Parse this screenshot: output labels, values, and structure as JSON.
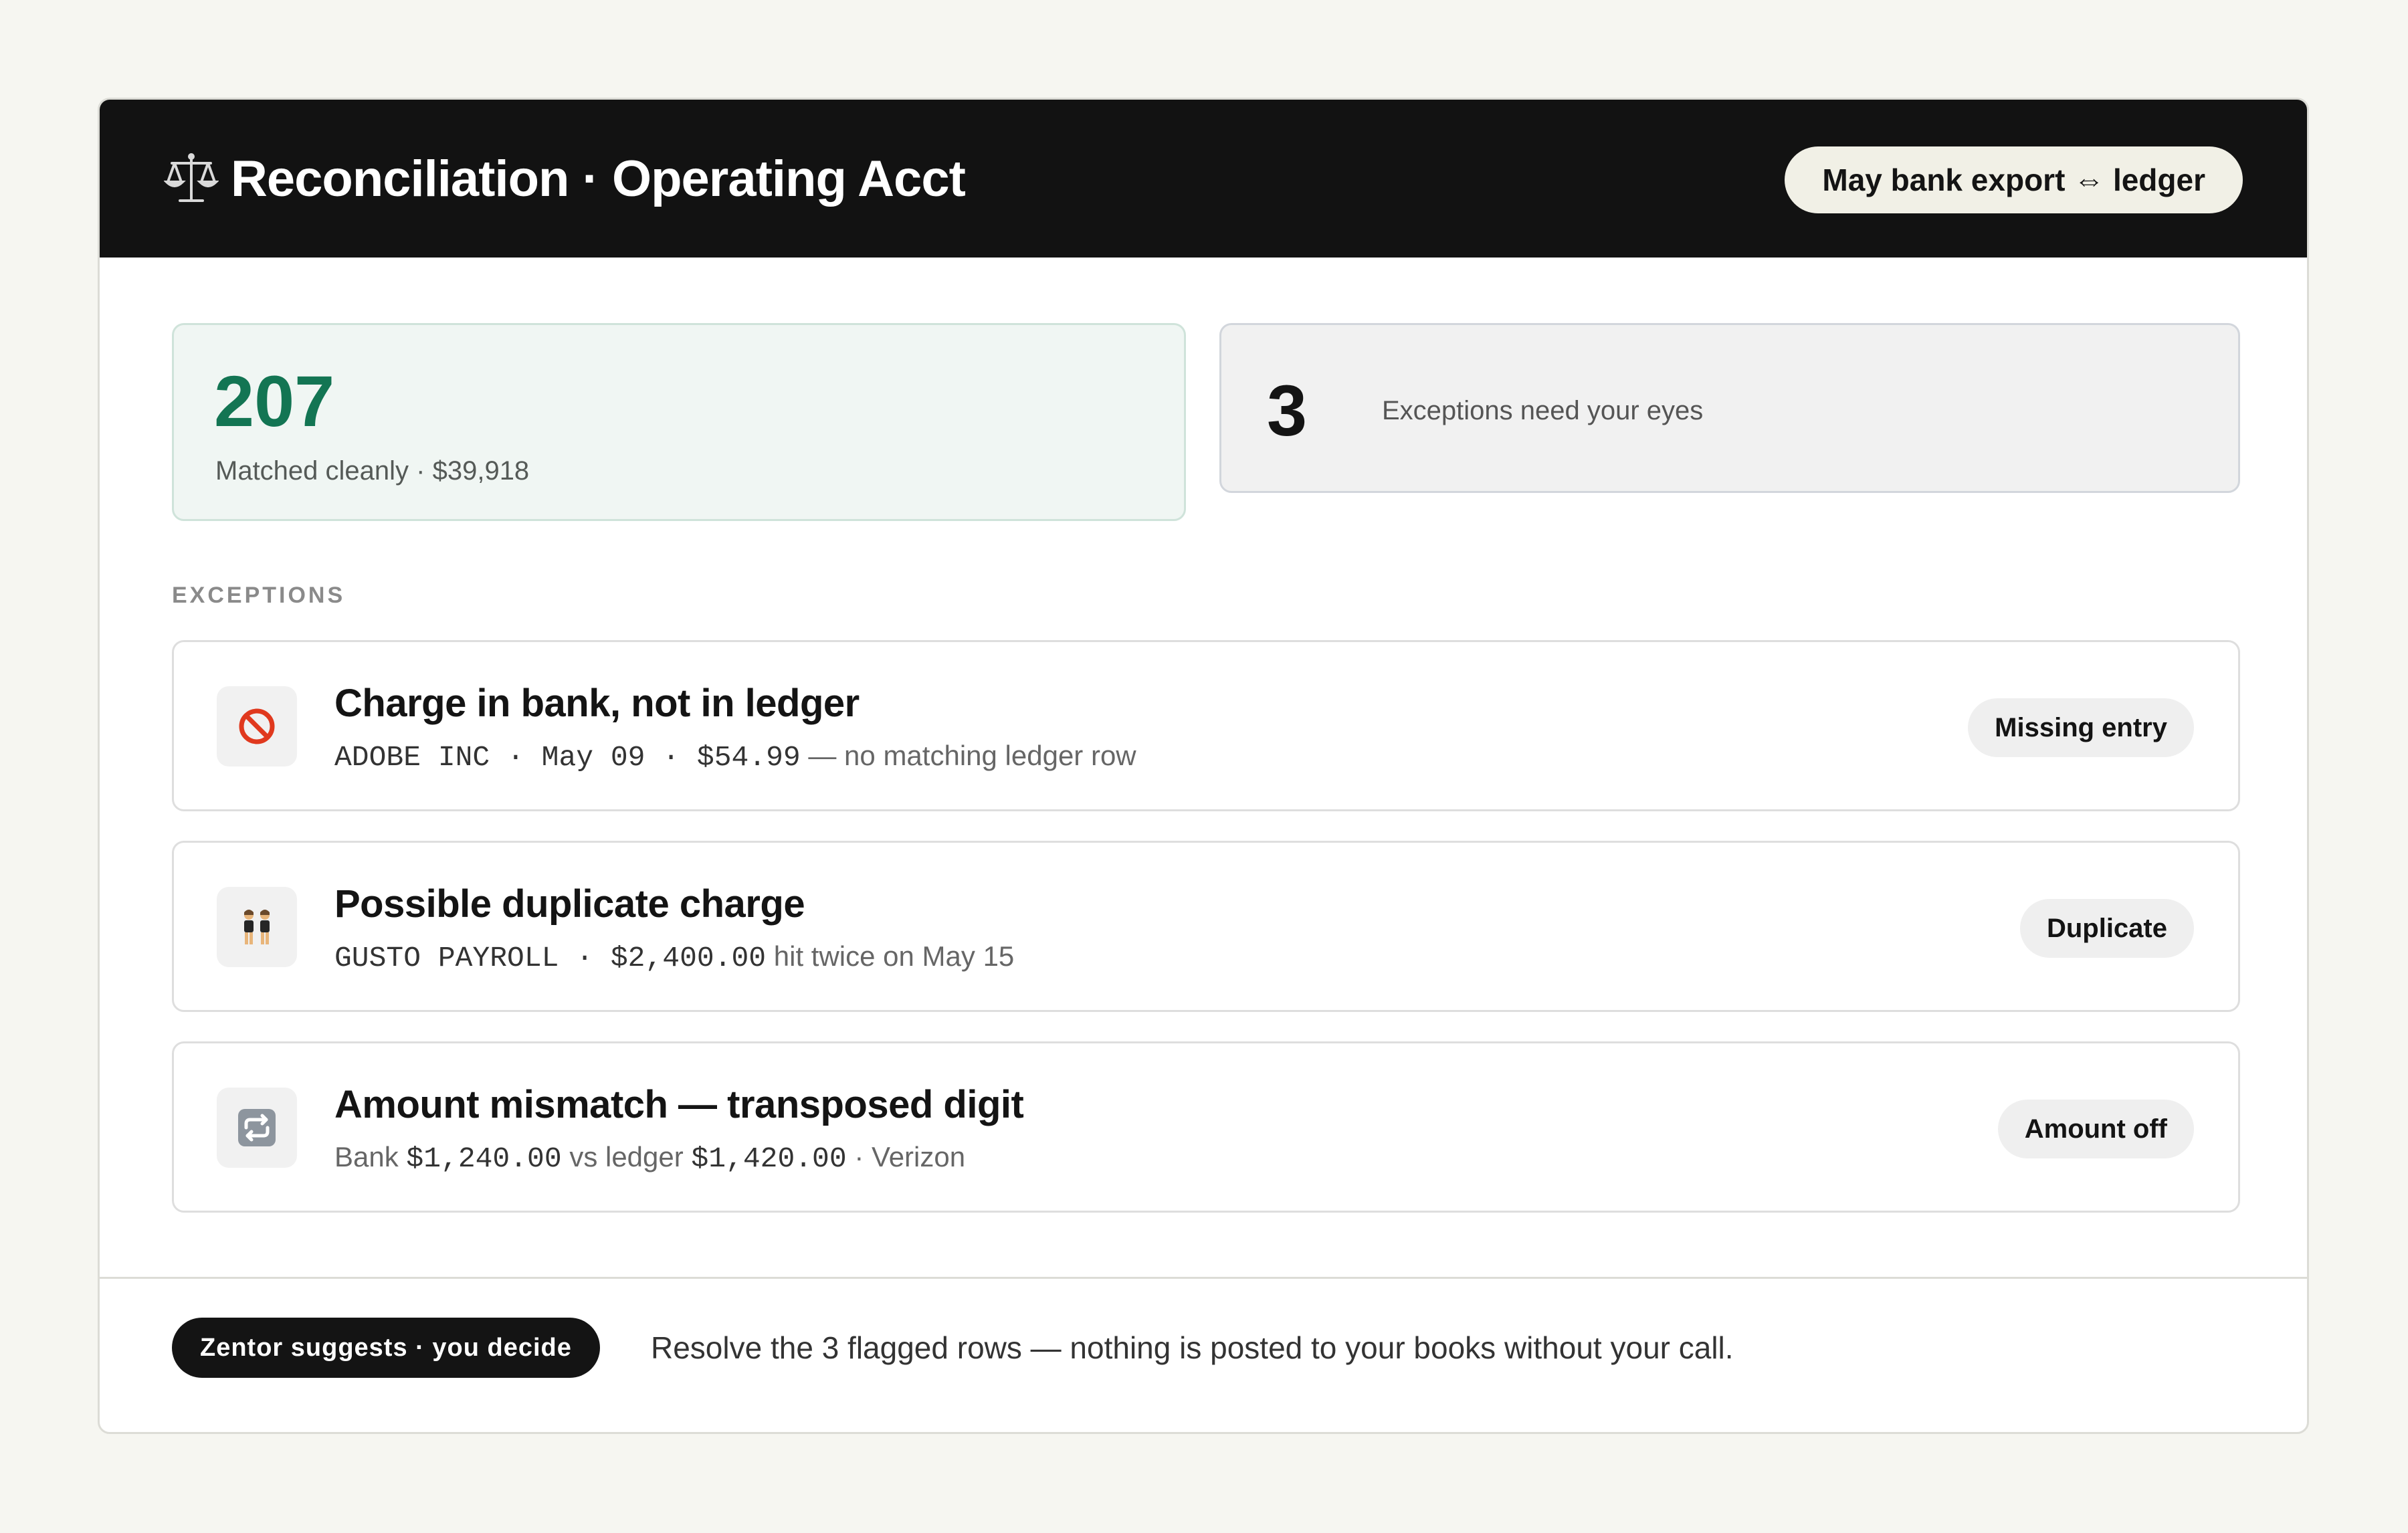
{
  "header": {
    "icon": "balance-scale-icon",
    "title": "Reconciliation · Operating Acct",
    "pill_label": "May bank export ⇔ ledger"
  },
  "stats": {
    "matched": {
      "value": "207",
      "label": "Matched cleanly · $39,918",
      "color": "#137553"
    },
    "exceptions": {
      "value": "3",
      "label": "Exceptions need your eyes"
    }
  },
  "exceptions": {
    "section_label": "EXCEPTIONS",
    "rows": [
      {
        "icon": "prohibited-icon",
        "title": "Charge in bank, not in ledger",
        "detail_mono": "ADOBE INC · May 09 · $54.99",
        "detail_rest": " — no matching ledger row",
        "tag": "Missing entry"
      },
      {
        "icon": "twins-icon",
        "title": "Possible duplicate charge",
        "detail_mono": "GUSTO PAYROLL · $2,400.00",
        "detail_rest": " hit twice on May 15",
        "tag": "Duplicate"
      },
      {
        "icon": "repeat-icon",
        "title": "Amount mismatch — transposed digit",
        "detail_pre": "Bank ",
        "detail_mono_a": "$1,240.00",
        "detail_mid": " vs ledger ",
        "detail_mono_b": "$1,420.00",
        "detail_post": " · Verizon",
        "tag": "Amount off"
      }
    ]
  },
  "footer": {
    "pill_label": "Zentor suggests · you decide",
    "text": "Resolve the 3 flagged rows — nothing is posted to your books without your call."
  }
}
